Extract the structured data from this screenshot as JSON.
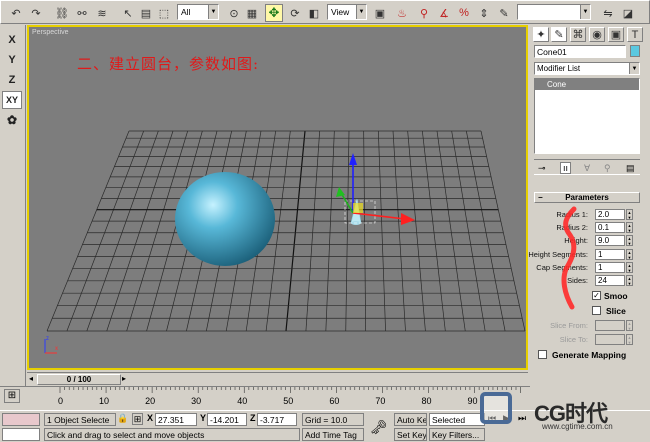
{
  "toolbar": {
    "selection_filter": "All",
    "ref_coord": "View",
    "named_selection": ""
  },
  "left_axes": [
    {
      "name": "axis-x-button",
      "label": "X",
      "active": false
    },
    {
      "name": "axis-y-button",
      "label": "Y",
      "active": false
    },
    {
      "name": "axis-z-button",
      "label": "Z",
      "active": false
    },
    {
      "name": "axis-xy-button",
      "label": "XY",
      "active": true
    }
  ],
  "viewport": {
    "label": "Perspective",
    "annotation": "二、建立圆台，参数如图:"
  },
  "command_panel": {
    "object_name": "Cone01",
    "object_color": "#5ac8e0",
    "modifier_list": "Modifier List",
    "stack_item": "Cone",
    "rollout_title": "Parameters",
    "params": [
      {
        "label": "Radius 1:",
        "value": "2.0"
      },
      {
        "label": "Radius 2:",
        "value": "0.1"
      },
      {
        "label": "Height:",
        "value": "9.0"
      },
      {
        "label": "Height Segments:",
        "value": "1"
      },
      {
        "label": "Cap Segments:",
        "value": "1"
      },
      {
        "label": "Sides:",
        "value": "24"
      }
    ],
    "smooth_label": "Smoo",
    "smooth_checked": true,
    "slice_label": "Slice",
    "slice_checked": false,
    "slice_from_label": "Slice From:",
    "slice_to_label": "Slice To:",
    "generate_mapping_label": "Generate Mapping",
    "generate_mapping_checked": false
  },
  "timeline": {
    "slider_label": "0 / 100",
    "ticks": [
      "0",
      "10",
      "20",
      "30",
      "40",
      "50",
      "60",
      "70",
      "80",
      "90"
    ]
  },
  "status": {
    "selection_info": "1 Object Selecte",
    "x_label": "X",
    "x_value": "27.351",
    "y_label": "Y",
    "y_value": "-14.201",
    "z_label": "Z",
    "z_value": "-3.717",
    "grid": "Grid = 10.0",
    "prompt": "Click and drag to select and move objects",
    "add_time_tag": "Add Time Tag",
    "auto_key": "Auto Key",
    "set_key": "Set Key",
    "key_mode": "Selected",
    "key_filters": "Key Filters..."
  },
  "watermark": {
    "brand": "CG时代",
    "url": "www.cgtime.com.cn"
  }
}
